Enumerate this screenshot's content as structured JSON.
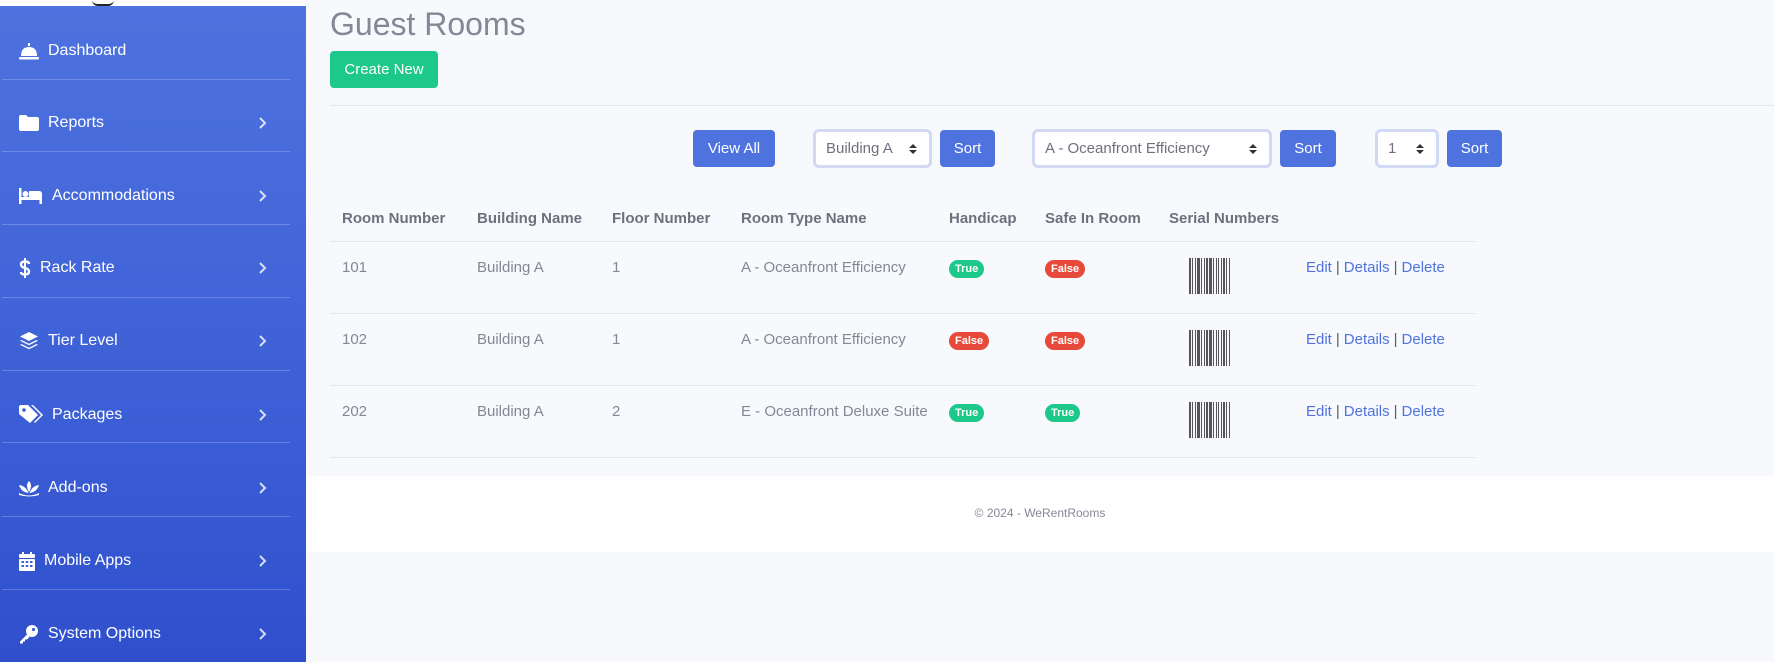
{
  "sidebar": {
    "items": [
      {
        "label": "Dashboard",
        "icon": "bell-concierge-icon",
        "has_chevron": false
      },
      {
        "label": "Reports",
        "icon": "folder-icon",
        "has_chevron": true
      },
      {
        "label": "Accommodations",
        "icon": "bed-icon",
        "has_chevron": true
      },
      {
        "label": "Rack Rate",
        "icon": "dollar-icon",
        "has_chevron": true
      },
      {
        "label": "Tier Level",
        "icon": "layers-icon",
        "has_chevron": true
      },
      {
        "label": "Packages",
        "icon": "tags-icon",
        "has_chevron": true
      },
      {
        "label": "Add-ons",
        "icon": "spa-icon",
        "has_chevron": true
      },
      {
        "label": "Mobile Apps",
        "icon": "calendar-icon",
        "has_chevron": true
      },
      {
        "label": "System Options",
        "icon": "key-icon",
        "has_chevron": true
      }
    ]
  },
  "page": {
    "title": "Guest Rooms",
    "create_label": "Create New"
  },
  "filters": {
    "view_all_label": "View All",
    "building_select": "Building A",
    "room_type_select": "A - Oceanfront Efficiency",
    "floor_select": "1",
    "sort_label": "Sort"
  },
  "table": {
    "headers": [
      "Room Number",
      "Building Name",
      "Floor Number",
      "Room Type Name",
      "Handicap",
      "Safe In Room",
      "Serial Numbers"
    ],
    "rows": [
      {
        "room_number": "101",
        "building": "Building A",
        "floor": "1",
        "room_type": "A - Oceanfront Efficiency",
        "handicap": "True",
        "safe": "False"
      },
      {
        "room_number": "102",
        "building": "Building A",
        "floor": "1",
        "room_type": "A - Oceanfront Efficiency",
        "handicap": "False",
        "safe": "False"
      },
      {
        "room_number": "202",
        "building": "Building A",
        "floor": "2",
        "room_type": "E - Oceanfront Deluxe Suite",
        "handicap": "True",
        "safe": "True"
      }
    ],
    "actions": {
      "edit": "Edit",
      "details": "Details",
      "delete": "Delete",
      "separator": "|"
    }
  },
  "footer": {
    "text": "© 2024 - WeRentRooms"
  },
  "colors": {
    "primary": "#4e73df",
    "success": "#1cc88a",
    "danger": "#e74a3b",
    "text": "#858796"
  }
}
